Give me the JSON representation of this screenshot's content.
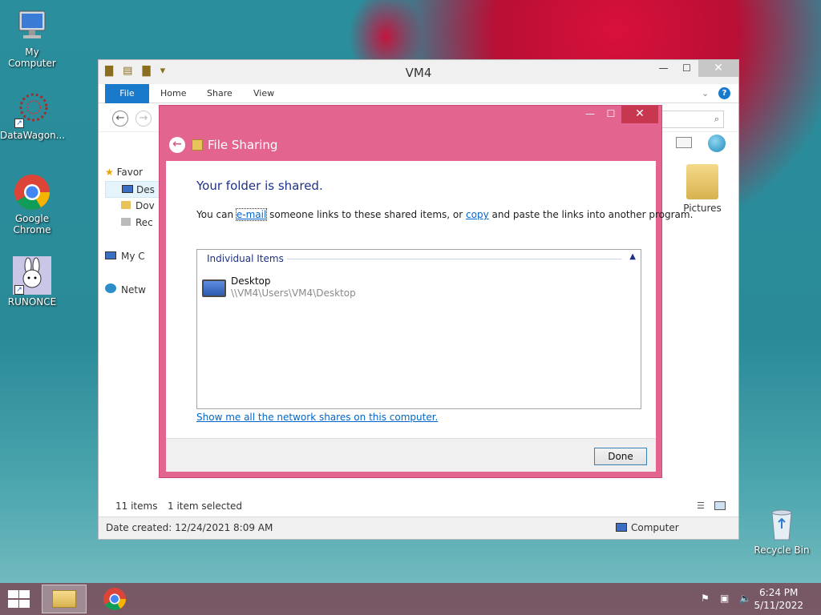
{
  "desktop": {
    "icons": [
      {
        "label": "My Computer",
        "icon": "computer-icon"
      },
      {
        "label": "DataWagon...",
        "icon": "datawagon-icon"
      },
      {
        "label": "Google Chrome",
        "icon": "chrome-icon"
      },
      {
        "label": "RUNONCE",
        "icon": "bunny-icon"
      },
      {
        "label": "Recycle Bin",
        "icon": "recycle-bin-icon"
      }
    ]
  },
  "explorer": {
    "title": "VM4",
    "ribbon_tabs": [
      "File",
      "Home",
      "Share",
      "View"
    ],
    "nav_items": [
      "Favor",
      "Des",
      "Dov",
      "Rec",
      "My C",
      "Netw"
    ],
    "pictures_label": "Pictures",
    "status": {
      "items": "11 items",
      "selected": "1 item selected"
    },
    "details": {
      "date_created": "Date created: 12/24/2021 8:09 AM",
      "location": "Computer"
    }
  },
  "dialog": {
    "title": "File Sharing",
    "heading": "Your folder is shared.",
    "text_before_email": "You can ",
    "email_link": "e-mail",
    "text_middle": " someone links to these shared items, or ",
    "copy_link": "copy",
    "text_after": " and paste the links into another program.",
    "group_header": "Individual Items",
    "item": {
      "name": "Desktop",
      "path": "\\\\VM4\\Users\\VM4\\Desktop"
    },
    "network_link": "Show me all the network shares on this computer.",
    "done_label": "Done"
  },
  "taskbar": {
    "time": "6:24 PM",
    "date": "5/11/2022"
  }
}
